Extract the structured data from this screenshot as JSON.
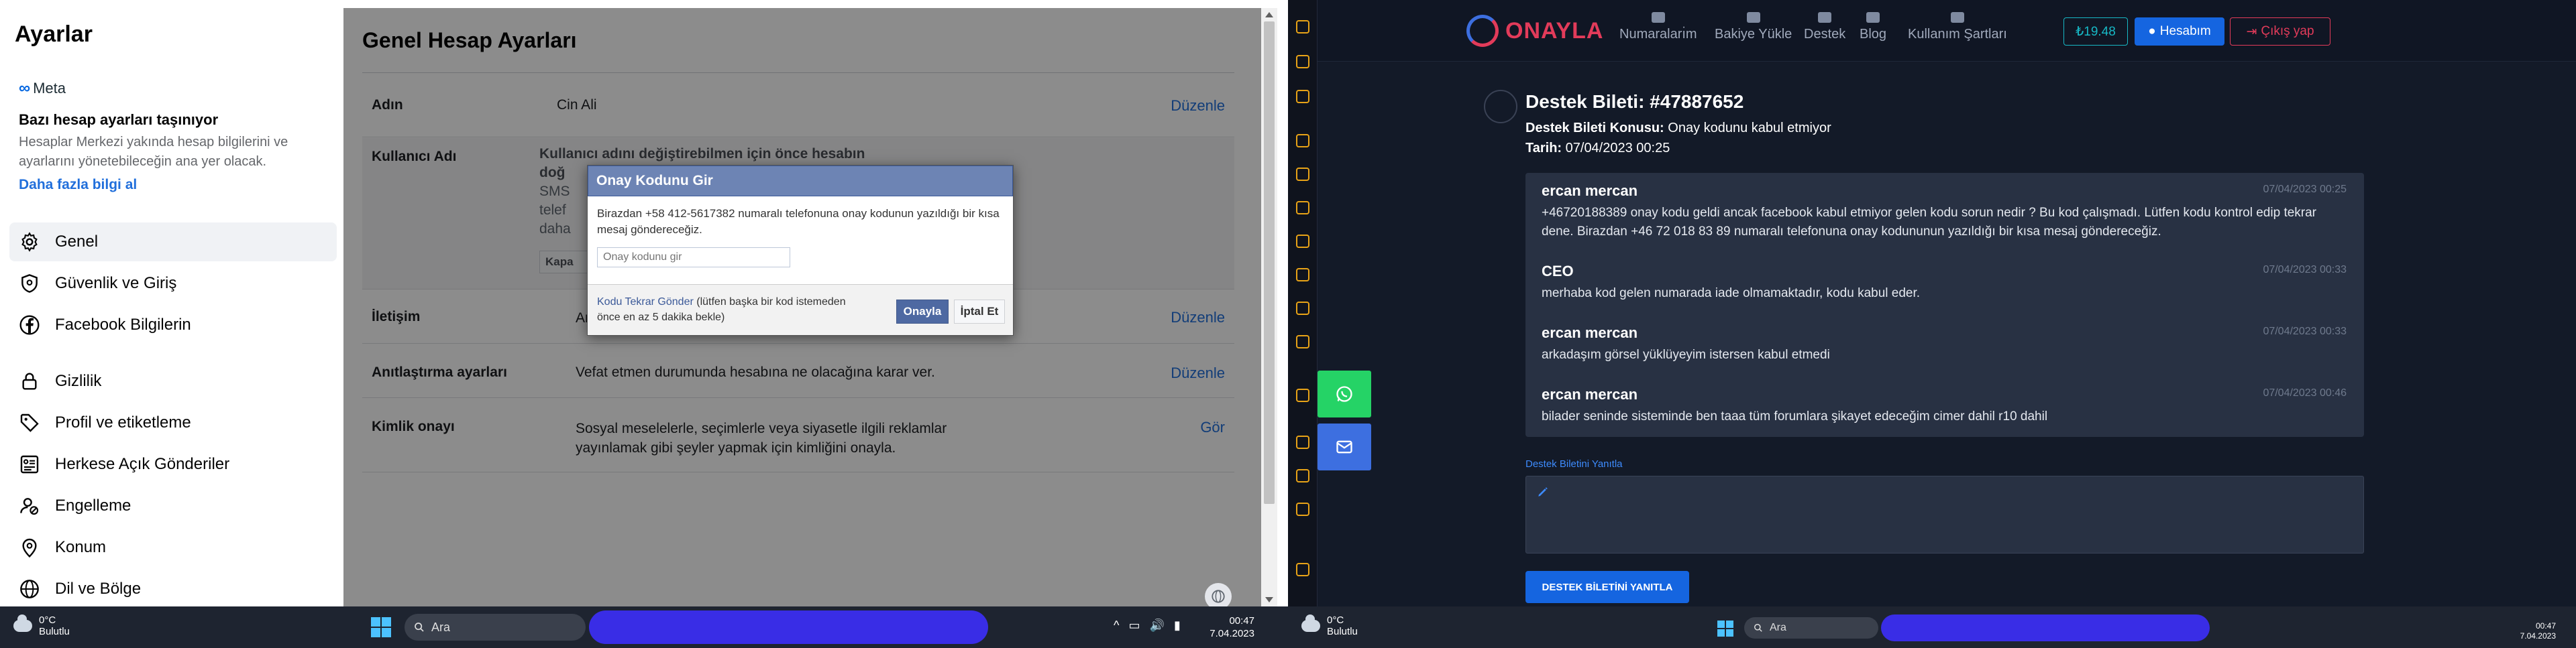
{
  "left": {
    "sidebar": {
      "title": "Ayarlar",
      "meta_logo": "Meta",
      "moving_title": "Bazı hesap ayarları taşınıyor",
      "moving_desc": "Hesaplar Merkezi yakında hesap bilgilerini ve ayarlarını yönetebileceğin ana yer olacak.",
      "learn_more": "Daha fazla bilgi al",
      "items": [
        {
          "label": "Genel",
          "icon": "gear-icon"
        },
        {
          "label": "Güvenlik ve Giriş",
          "icon": "shield-icon"
        },
        {
          "label": "Facebook Bilgilerin",
          "icon": "facebook-icon"
        },
        {
          "label": "Gizlilik",
          "icon": "lock-icon"
        },
        {
          "label": "Profil ve etiketleme",
          "icon": "tag-icon"
        },
        {
          "label": "Herkese Açık Gönderiler",
          "icon": "feed-icon"
        },
        {
          "label": "Engelleme",
          "icon": "block-user-icon"
        },
        {
          "label": "Konum",
          "icon": "location-pin-icon"
        },
        {
          "label": "Dil ve Bölge",
          "icon": "globe-icon"
        }
      ]
    },
    "main": {
      "title": "Genel Hesap Ayarları",
      "rows": {
        "name": {
          "label": "Adın",
          "value": "Cin Ali",
          "action": "Düzenle"
        },
        "username": {
          "label": "Kullanıcı Adı",
          "line1": "Kullanıcı adını değiştirebilmen için önce hesabın",
          "line2": "doğ",
          "line3": "SMS",
          "line4": "telef",
          "line5": "daha",
          "button": "Kapa"
        },
        "contact": {
          "label": "İletişim",
          "value": "Ana",
          "action": "Düzenle"
        },
        "memorial": {
          "label": "Anıtlaştırma ayarları",
          "value": "Vefat etmen durumunda hesabına ne olacağına karar ver.",
          "action": "Düzenle"
        },
        "identity": {
          "label": "Kimlik onayı",
          "value": "Sosyal meselelerle, seçimlerle veya siyasetle ilgili reklamlar yayınlamak gibi şeyler yapmak için kimliğini onayla.",
          "action": "Gör"
        }
      }
    },
    "dialog": {
      "title": "Onay Kodunu Gir",
      "body": "Birazdan +58 412-5617382 numaralı telefonuna onay kodunun yazıldığı bir kısa mesaj göndereceğiz.",
      "input_placeholder": "Onay kodunu gir",
      "resend_link": "Kodu Tekrar Gönder",
      "resend_note": " (lütfen başka bir kod istemeden önce en az 5 dakika bekle)",
      "confirm": "Onayla",
      "cancel": "İptal Et"
    },
    "taskbar": {
      "temp": "0°C",
      "weather": "Bulutlu",
      "search": "Ara",
      "time": "00:47",
      "date": "7.04.2023"
    }
  },
  "right": {
    "header": {
      "logo": "ONAYLA",
      "nav": [
        "Numaraları̇m",
        "Bakiye Yükle",
        "Destek",
        "Blog",
        "Kullanım Şartları"
      ],
      "balance": "₺19.48",
      "account": "Hesabım",
      "logout": "Çıkış yap"
    },
    "ticket": {
      "title": "Destek Bileti: #47887652",
      "subject_label": "Destek Bileti Konusu:",
      "subject": " Onay kodunu kabul etmiyor",
      "date_label": "Tarih:",
      "date": " 07/04/2023 00:25",
      "messages": [
        {
          "who": "ercan mercan",
          "when": "07/04/2023 00:25",
          "text": "+46720188389 onay kodu geldi ancak facebook kabul etmiyor gelen kodu sorun nedir ? Bu kod çalışmadı. Lütfen kodu kontrol edip tekrar dene. Birazdan +46 72 018 83 89 numaralı telefonuna onay kodununun yazıldığı bir kısa mesaj göndereceğiz."
        },
        {
          "who": "CEO",
          "when": "07/04/2023 00:33",
          "text": "merhaba kod gelen numarada iade olmamaktadır, kodu kabul eder."
        },
        {
          "who": "ercan mercan",
          "when": "07/04/2023 00:33",
          "text": "arkadaşım görsel yüklüyeyim istersen kabul etmedi"
        },
        {
          "who": "ercan mercan",
          "when": "07/04/2023 00:46",
          "text": "bilader seninde sisteminde ben taaa tüm forumlara şikayet edeceğim cimer dahil r10 dahil"
        }
      ],
      "reply_label": "Destek Biletini Yanıtla",
      "reply_button": "DESTEK BİLETİNİ YANITLA"
    },
    "taskbar": {
      "temp": "0°C",
      "weather": "Bulutlu",
      "search": "Ara",
      "time": "00:47",
      "date": "7.04.2023"
    }
  }
}
